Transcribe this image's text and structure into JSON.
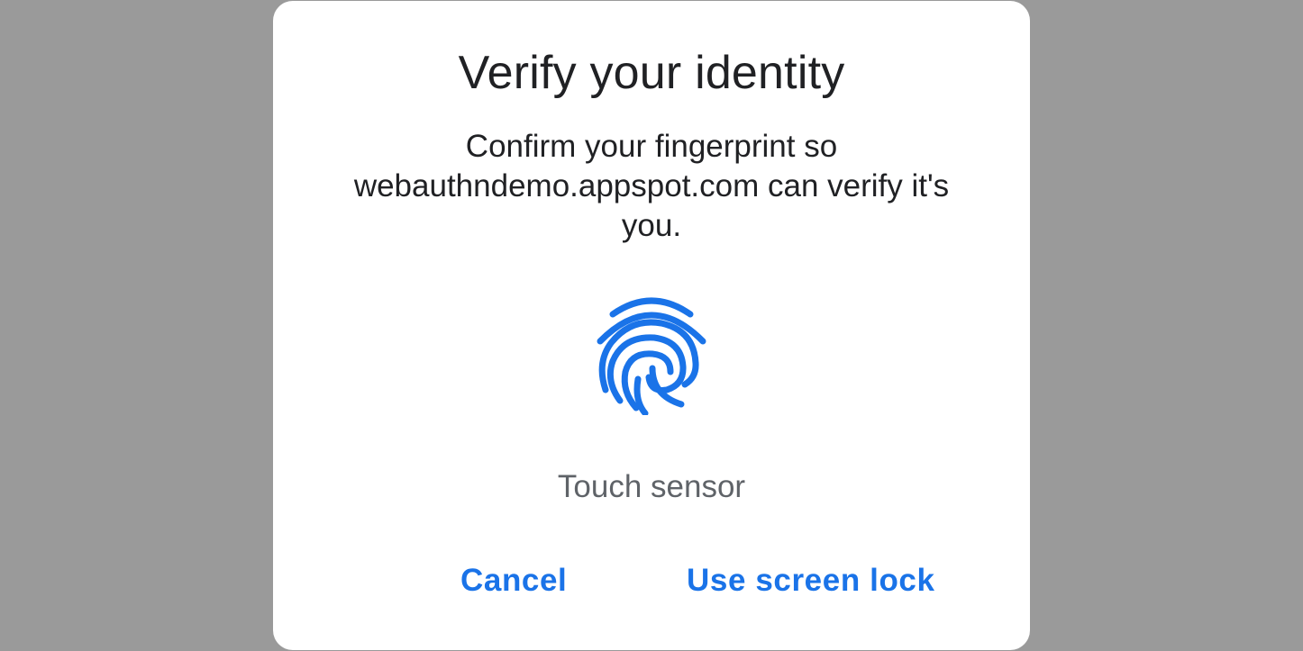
{
  "dialog": {
    "title": "Verify your identity",
    "subtitle_lines": [
      "Confirm your fingerprint so",
      "webauthndemo.appspot.com can verify it's",
      "you."
    ],
    "icon": "fingerprint-icon",
    "status": "Touch sensor",
    "buttons": {
      "cancel": "Cancel",
      "screen_lock": "Use screen lock"
    }
  },
  "colors": {
    "scrim": "#9a9a9a",
    "surface": "#ffffff",
    "accent": "#1a73e8",
    "text_primary": "#202124",
    "text_secondary": "#5f6368"
  }
}
